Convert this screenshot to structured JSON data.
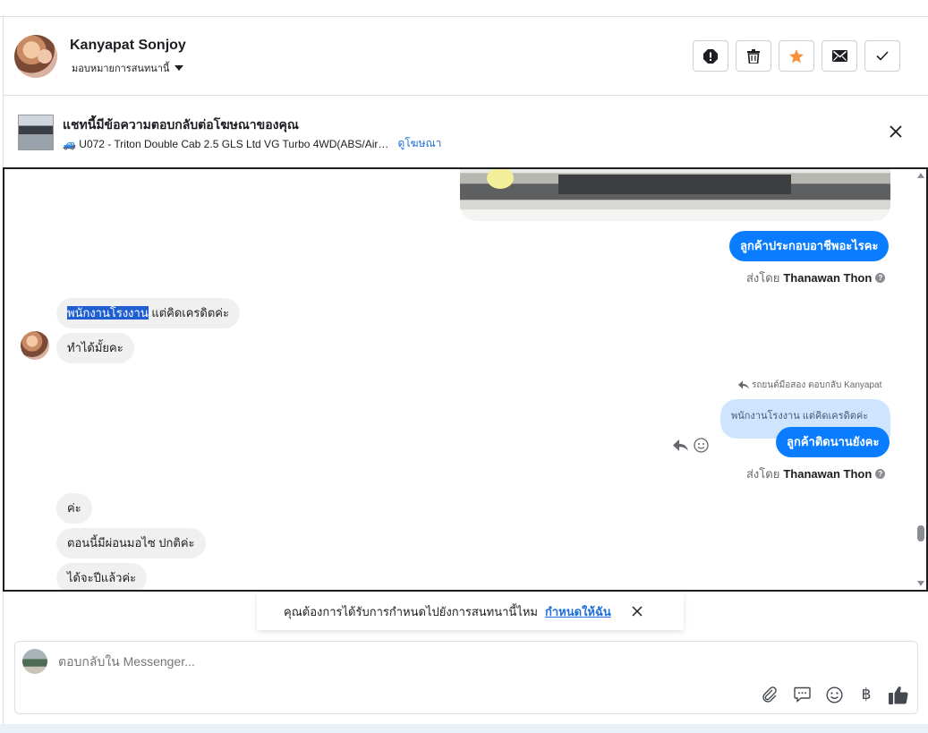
{
  "header": {
    "contact_name": "Kanyapat Sonjoy",
    "assign_label": "มอบหมายการสนทนานี้",
    "actions": [
      {
        "name": "spam-icon"
      },
      {
        "name": "trash-icon"
      },
      {
        "name": "star-icon",
        "color": "#f7923b"
      },
      {
        "name": "mail-icon"
      },
      {
        "name": "check-icon"
      }
    ]
  },
  "ad_banner": {
    "title": "แชทนี้มีข้อความตอบกลับต่อโฆษณาของคุณ",
    "subtitle": "🚙 U072 - Triton Double Cab 2.5 GLS Ltd VG Turbo 4WD(ABS/Air…",
    "link_label": "ดูโฆษณา"
  },
  "messages": {
    "out_1": "ลูกค้าประกอบอาชีพอะไรคะ",
    "sent_by_prefix": "ส่งโดย",
    "sent_by_name": "Thanawan Thon",
    "in_1_highlight": "พนักงานโรงงาน",
    "in_1_rest": " แต่คิดเครดิตค่ะ",
    "in_2": "ทำได้มั้ยคะ",
    "reply_header": "รถยนต์มือสอง ตอบกลับ Kanyapat",
    "quoted": "พนักงานโรงงาน แต่คิดเครดิตค่ะ",
    "out_2": "ลูกค้าติดนานยังคะ",
    "in_3": "ค่ะ",
    "in_4": "ตอนนี้มีผ่อนมอไซ ปกติค่ะ",
    "in_5": "ได้จะปีแล้วค่ะ"
  },
  "toast": {
    "text": "คุณต้องการได้รับการกำหนดไปยังการสนทนานี้ไหม",
    "link_label": "กำหนดให้ฉัน"
  },
  "composer": {
    "placeholder": "ตอบกลับใน Messenger..."
  },
  "colors": {
    "accent": "#0a7cff",
    "link": "#216fdb"
  }
}
